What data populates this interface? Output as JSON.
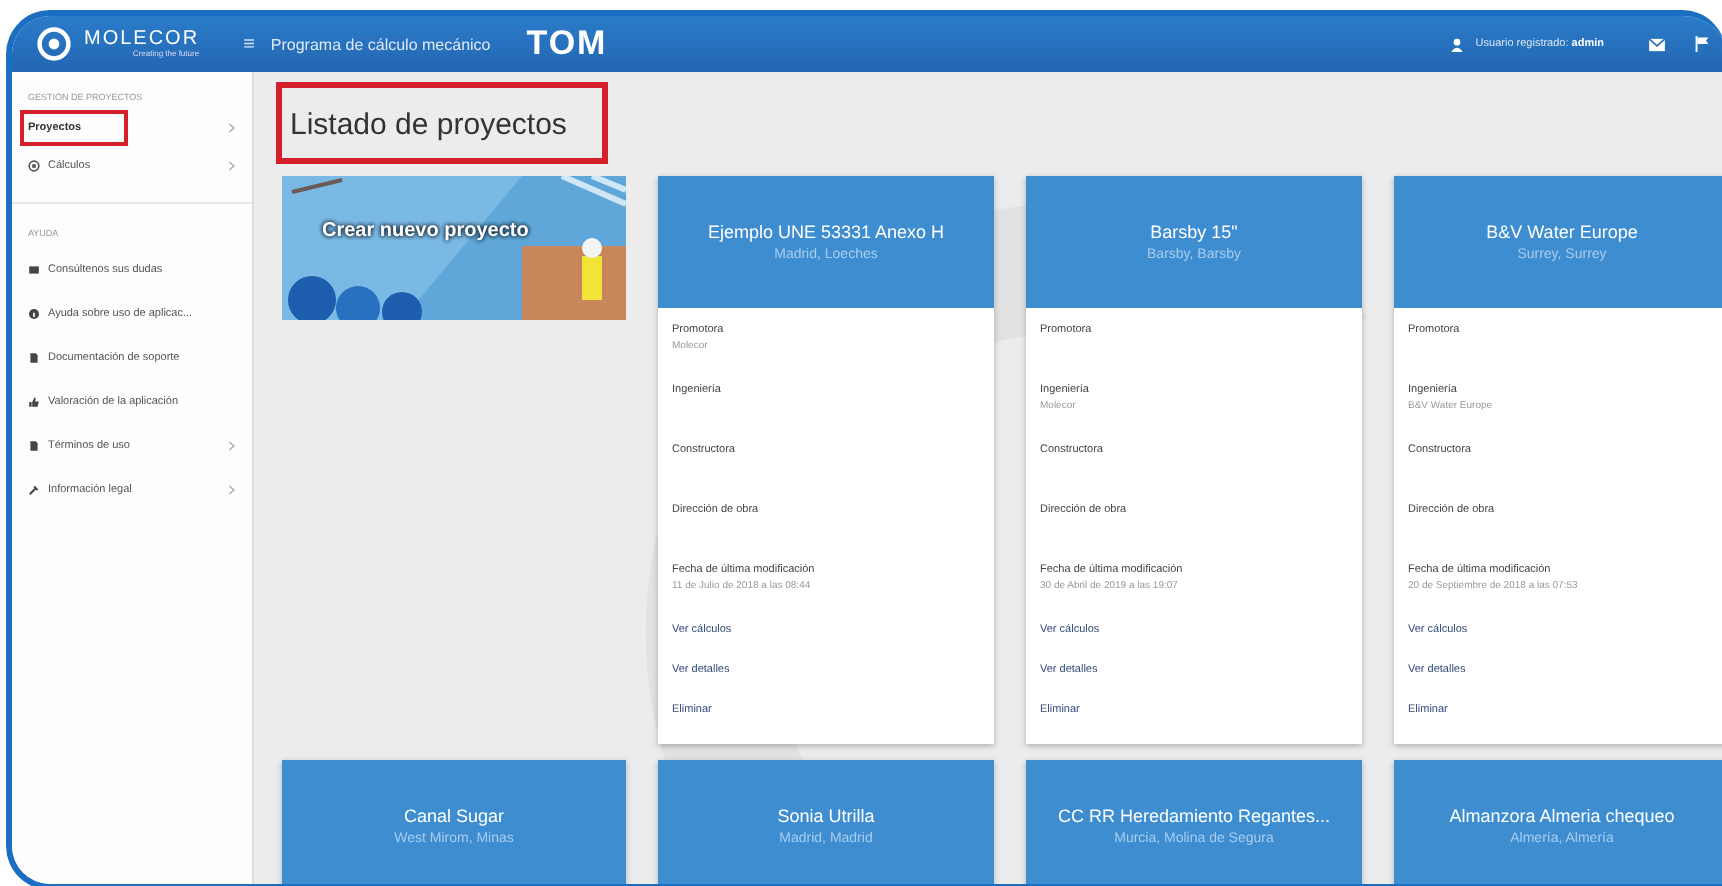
{
  "header": {
    "brand": "MOLECOR",
    "tagline": "Creating the future",
    "menu_glyph": "≡",
    "app_title": "Programa de cálculo mecánico",
    "app_logo": "TOM",
    "user_label": "Usuario registrado: **admin**"
  },
  "sidebar": {
    "sections": [
      {
        "heading": "GESTIÓN DE PROYECTOS",
        "items": [
          {
            "label": "Proyectos",
            "chevron": true,
            "highlighted": true
          },
          {
            "label": "Cálculos",
            "chevron": true,
            "highlighted": false
          }
        ]
      },
      {
        "heading": "AYUDA",
        "items": [
          {
            "label": "Consúltenos sus dudas",
            "chevron": false,
            "highlighted": false
          },
          {
            "label": "Ayuda sobre uso de aplicac...",
            "chevron": false,
            "highlighted": false
          },
          {
            "label": "Documentación de soporte",
            "chevron": false,
            "highlighted": false
          },
          {
            "label": "Valoración de la aplicación",
            "chevron": false,
            "highlighted": false
          },
          {
            "label": "Términos de uso",
            "chevron": true,
            "highlighted": false
          },
          {
            "label": "Información legal",
            "chevron": true,
            "highlighted": false
          }
        ]
      }
    ]
  },
  "page": {
    "title": "Listado de proyectos",
    "title_highlighted": true
  },
  "cards": [
    {
      "kind": "create",
      "label": "Crear nuevo proyecto"
    },
    {
      "kind": "project",
      "title": "Ejemplo UNE 53331 Anexo H",
      "location": "Madrid, Loeches",
      "fields": [
        {
          "label": "Promotora",
          "value": "Molecor"
        },
        {
          "label": "Ingeniería"
        },
        {
          "label": "Constructora"
        },
        {
          "label": "Dirección de obra"
        },
        {
          "label": "Fecha de última modificación",
          "value": "11 de Julio de 2018 a las 08:44"
        }
      ],
      "actions": [
        "Ver cálculos",
        "Ver detalles",
        "Eliminar"
      ]
    },
    {
      "kind": "project",
      "title": "Barsby 15\"",
      "location": "Barsby, Barsby",
      "fields": [
        {
          "label": "Promotora"
        },
        {
          "label": "Ingeniería",
          "value": "Molecor"
        },
        {
          "label": "Constructora"
        },
        {
          "label": "Dirección de obra"
        },
        {
          "label": "Fecha de última modificación",
          "value": "30 de Abril de 2019 a las 19:07"
        }
      ],
      "actions": [
        "Ver cálculos",
        "Ver detalles",
        "Eliminar"
      ]
    },
    {
      "kind": "project",
      "title": "B&V Water Europe",
      "location": "Surrey, Surrey",
      "fields": [
        {
          "label": "Promotora"
        },
        {
          "label": "Ingeniería",
          "value": "B&V Water Europe"
        },
        {
          "label": "Constructora"
        },
        {
          "label": "Dirección de obra"
        },
        {
          "label": "Fecha de última modificación",
          "value": "20 de Septiembre de 2018 a las 07:53"
        }
      ],
      "actions": [
        "Ver cálculos",
        "Ver detalles",
        "Eliminar"
      ]
    },
    {
      "kind": "project",
      "title": "Canal Sugar",
      "location": "West Mirom, Minas"
    },
    {
      "kind": "project",
      "title": "Sonia Utrilla",
      "location": "Madrid, Madrid"
    },
    {
      "kind": "project",
      "title": "CC RR Heredamiento Regantes...",
      "location": "Murcia, Molina de Segura"
    },
    {
      "kind": "project",
      "title": "Almanzora Almeria chequeo",
      "location": "Almería, Almería"
    }
  ]
}
